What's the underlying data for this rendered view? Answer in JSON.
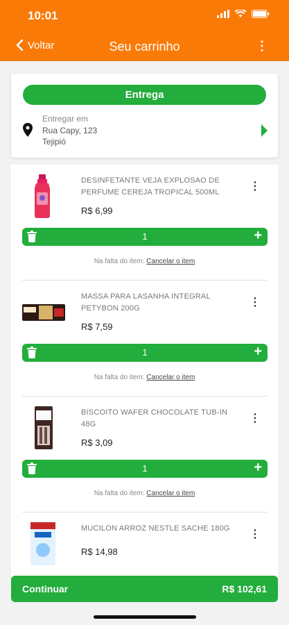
{
  "status": {
    "time": "10:01"
  },
  "header": {
    "back_label": "Voltar",
    "title": "Seu carrinho"
  },
  "delivery": {
    "mode_label": "Entrega",
    "address_label": "Entregar em",
    "street": "Rua Capy, 123",
    "district": "Tejipió"
  },
  "items": [
    {
      "name": "DESINFETANTE VEJA EXPLOSAO DE PERFUME CEREJA TROPICAL 500ML",
      "price": "R$ 6,99",
      "quantity": "1",
      "missing_label": "Na falta do item:",
      "cancel_label": "Cancelar o item"
    },
    {
      "name": "MASSA PARA LASANHA INTEGRAL PETYBON 200G",
      "price": "R$ 7,59",
      "quantity": "1",
      "missing_label": "Na falta do item:",
      "cancel_label": "Cancelar o item"
    },
    {
      "name": "BISCOITO WAFER CHOCOLATE TUB-IN 48G",
      "price": "R$ 3,09",
      "quantity": "1",
      "missing_label": "Na falta do item:",
      "cancel_label": "Cancelar o item"
    },
    {
      "name": "MUCILON ARROZ NESTLE SACHE 180G",
      "price": "R$ 14,98"
    }
  ],
  "footer": {
    "continue_label": "Continuar",
    "total": "R$ 102,61"
  },
  "colors": {
    "brand_orange": "#fa7a08",
    "action_green": "#22ad3c"
  }
}
